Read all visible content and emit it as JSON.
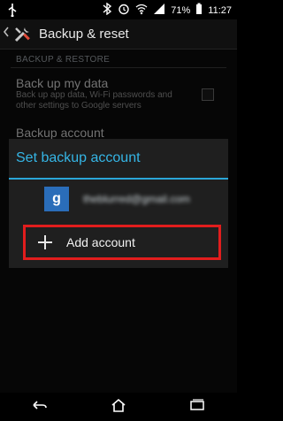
{
  "status_bar": {
    "battery_percent": "71%",
    "time": "11:27"
  },
  "action_bar": {
    "title": "Backup & reset"
  },
  "list": {
    "section_header": "BACKUP & RESTORE",
    "items": [
      {
        "title": "Back up my data",
        "subtitle": "Back up app data, Wi-Fi passwords and other settings to Google servers",
        "checked": false
      },
      {
        "title": "Backup account"
      }
    ]
  },
  "dialog": {
    "title": "Set backup account",
    "account_email": "theblurred@gmail.com",
    "add_account_label": "Add account"
  }
}
